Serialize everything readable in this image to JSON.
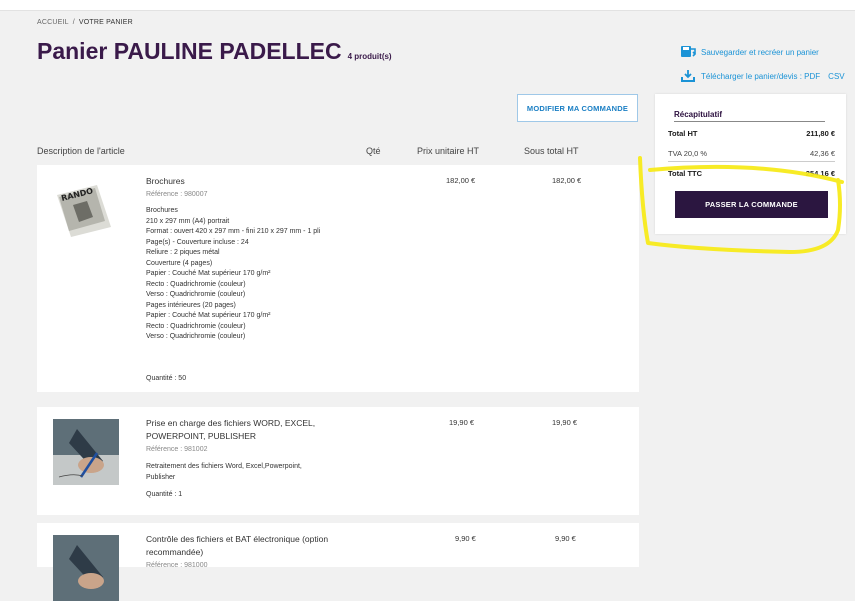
{
  "breadcrumb": {
    "home": "ACCUEIL",
    "separator": "/",
    "current": "VOTRE PANIER"
  },
  "cart": {
    "title": "Panier PAULINE PADELLEC",
    "count": "4 produit(s)"
  },
  "actions": {
    "save": "Sauvegarder et recréer un panier",
    "download": "Télécharger le panier/devis : PDF",
    "csv": "CSV",
    "save_icon": "save-cart-icon",
    "download_icon": "download-icon"
  },
  "modify_button": "MODIFIER MA COMMANDE",
  "columns": {
    "description": "Description de l'article",
    "qty": "Qté",
    "unit_price": "Prix unitaire HT",
    "subtotal": "Sous total HT"
  },
  "summary": {
    "title": "Récapitulatif",
    "total_ht_label": "Total HT",
    "total_ht_value": "211,80 €",
    "tva_label": "TVA 20,0 %",
    "tva_value": "42,36 €",
    "total_ttc_label": "Total TTC",
    "total_ttc_value": "254,16 €",
    "checkout_button": "PASSER LA COMMANDE"
  },
  "items": [
    {
      "name": "Brochures",
      "ref": "Référence : 980007",
      "unit_price": "182,00 €",
      "subtotal": "182,00 €",
      "quantity": "Quantité : 50",
      "thumb_text": "RANDO",
      "details": [
        "Brochures",
        "210 x 297 mm (A4) portrait",
        "Format : ouvert 420 x 297 mm - fini 210 x 297 mm - 1 pli",
        "Page(s) - Couverture incluse : 24",
        "Reliure : 2 piques métal",
        "Couverture (4 pages)",
        "Papier : Couché Mat supérieur 170 g/m²",
        "Recto : Quadrichromie (couleur)",
        "Verso : Quadrichromie (couleur)",
        "Pages intérieures (20 pages)",
        "Papier : Couché Mat supérieur 170 g/m²",
        "Recto : Quadrichromie (couleur)",
        "Verso : Quadrichromie (couleur)"
      ]
    },
    {
      "name": "Prise en charge des fichiers WORD, EXCEL, POWERPOINT, PUBLISHER",
      "ref": "Référence : 981002",
      "unit_price": "19,90 €",
      "subtotal": "19,90 €",
      "quantity": "Quantité : 1",
      "details": [
        "Retraitement des fichiers Word, Excel,Powerpoint, Publisher"
      ]
    },
    {
      "name": "Contrôle des fichiers et BAT électronique (option recommandée)",
      "ref": "Référence : 981000",
      "unit_price": "9,90 €",
      "subtotal": "9,90 €"
    }
  ],
  "colors": {
    "brand_purple": "#2b1640",
    "title_purple": "#3a1a4a",
    "link_blue": "#1b93d6",
    "highlight_yellow": "#f7ea1a"
  }
}
